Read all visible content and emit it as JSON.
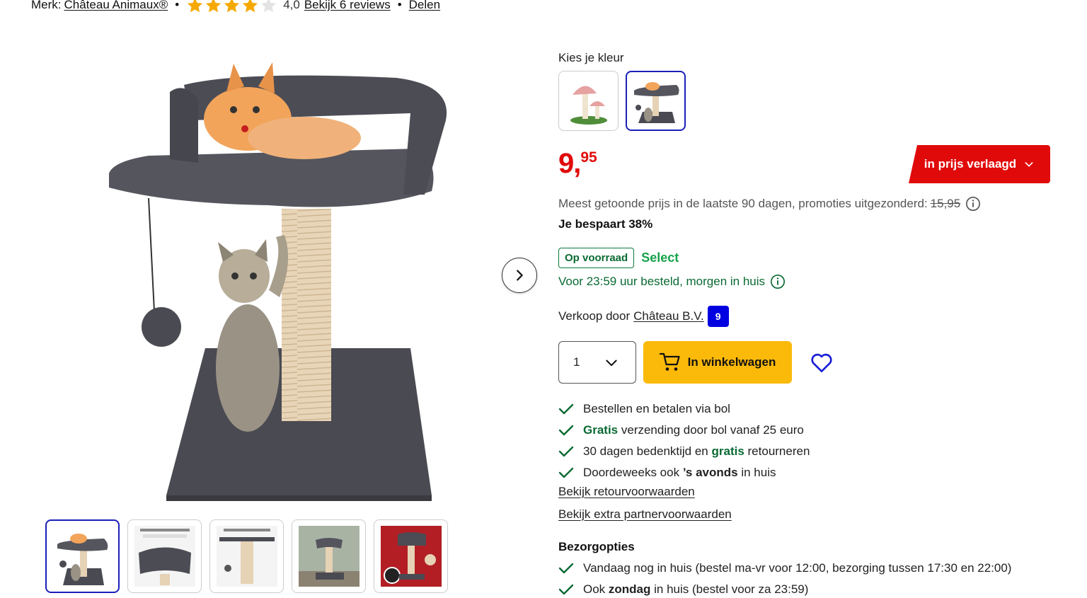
{
  "meta": {
    "brand_prefix": "Merk:",
    "brand": "Château Animaux®",
    "rating_value": "4,0",
    "rating_stars": 4,
    "reviews_link": "Bekijk 6 reviews",
    "share_link": "Delen"
  },
  "colors": {
    "price_red": "#e10a0a",
    "brand_blue": "#0000e0",
    "cart_yellow": "#fbb90a",
    "success_green": "#0a6a33",
    "star_gold": "#f5a900"
  },
  "color_picker": {
    "label": "Kies je kleur",
    "options": [
      {
        "name": "mushroom",
        "selected": false
      },
      {
        "name": "cat-tree-grey",
        "selected": true
      }
    ]
  },
  "price": {
    "integer": "9,",
    "decimals": "95",
    "badge": "in prijs verlaagd",
    "reference_text": "Meest getoonde prijs in de laatste 90 dagen, promoties uitgezonderd:",
    "reference_price": "15,95",
    "savings": "Je bespaart 38%"
  },
  "stock": {
    "badge": "Op voorraad",
    "select": "Select",
    "delivery": "Voor 23:59 uur besteld, morgen in huis"
  },
  "seller": {
    "prefix": "Verkoop door",
    "name": "Château B.V.",
    "score": "9"
  },
  "purchase": {
    "quantity": "1",
    "cart_label": "In winkelwagen"
  },
  "usps": {
    "u1": "Bestellen en betalen via bol",
    "u2_green": "Gratis",
    "u2_rest": " verzending door bol vanaf 25 euro",
    "u3_a": "30 dagen bedenktijd en ",
    "u3_green": "gratis",
    "u3_b": " retourneren",
    "u4_a": "Doordeweeks ook ",
    "u4_bold": "’s avonds",
    "u4_b": " in huis"
  },
  "links": {
    "returns": "Bekijk retourvoorwaarden",
    "partner": "Bekijk extra partnervoorwaarden"
  },
  "delivery_options": {
    "title": "Bezorgopties",
    "d1": "Vandaag nog in huis (bestel ma-vr voor 12:00, bezorging tussen 17:30 en 22:00)",
    "d2_a": "Ook ",
    "d2_bold": "zondag",
    "d2_b": " in huis (bestel voor za 23:59)"
  },
  "gallery": {
    "thumbnails": [
      {
        "name": "cat-tree-photo",
        "caption": ""
      },
      {
        "name": "bed-detail",
        "caption": ""
      },
      {
        "name": "post-detail",
        "caption": ""
      },
      {
        "name": "room-photo",
        "caption": ""
      },
      {
        "name": "red-banner",
        "caption": ""
      }
    ]
  }
}
